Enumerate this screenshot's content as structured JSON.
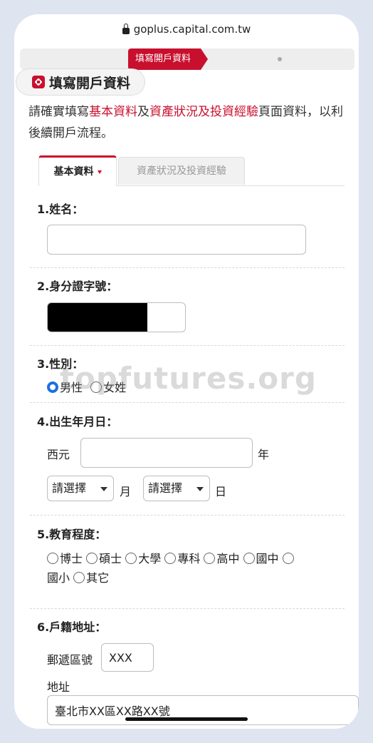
{
  "browser": {
    "url": "goplus.capital.com.tw"
  },
  "progress": {
    "active_step": "填寫開戶資料"
  },
  "page_title": "填寫開戶資料",
  "intro": {
    "part1": "請確實填寫",
    "link1": "基本資料",
    "part2": "及",
    "link2": "資產狀況及投資經驗",
    "part3": "頁面資料，以利後續開戶流程。"
  },
  "tabs": [
    {
      "label": "基本資料",
      "active": true
    },
    {
      "label": "資產狀況及投資經驗",
      "active": false
    }
  ],
  "fields": {
    "name": {
      "label": "1.姓名：",
      "value": ""
    },
    "id_number": {
      "label": "2.身分證字號："
    },
    "gender": {
      "label": "3.性別：",
      "options": [
        "男性",
        "女姓"
      ],
      "selected": "男性"
    },
    "birthday": {
      "label": "4.出生年月日：",
      "era_prefix": "西元",
      "year_suffix": "年",
      "month_placeholder": "請選擇",
      "month_suffix": "月",
      "day_placeholder": "請選擇",
      "day_suffix": "日"
    },
    "education": {
      "label": "5.教育程度：",
      "options": [
        "博士",
        "碩士",
        "大學",
        "專科",
        "高中",
        "國中",
        "國小",
        "其它"
      ]
    },
    "address": {
      "label": "6.戶籍地址：",
      "zip_label": "郵遞區號",
      "zip_value": "XXX",
      "addr_label": "地址",
      "addr_value": "臺北市XX區XX路XX號"
    }
  },
  "watermark": "topfutures.org",
  "colors": {
    "brand_red": "#c8102e",
    "radio_blue": "#1d6fe0"
  }
}
